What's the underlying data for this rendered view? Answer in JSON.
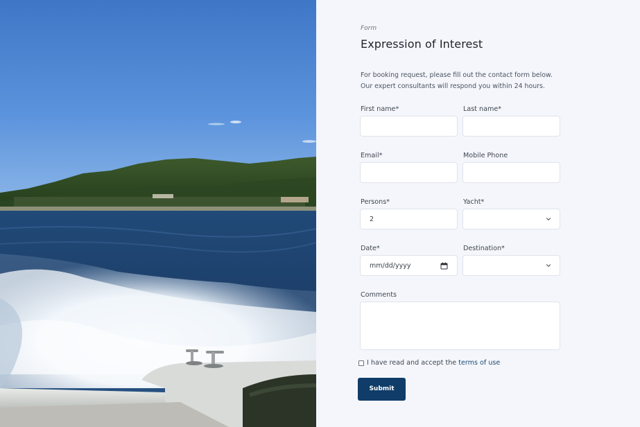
{
  "form": {
    "eyebrow": "Form",
    "title": "Expression of Interest",
    "intro": "For booking request, please fill out the contact form below. Our expert consultants will respond you within 24 hours.",
    "first_name_label": "First name*",
    "last_name_label": "Last name*",
    "email_label": "Email*",
    "mobile_label": "Mobile Phone",
    "persons_label": "Persons*",
    "persons_value": "2",
    "yacht_label": "Yacht*",
    "date_label": "Date*",
    "date_placeholder": "mm/dd/yyyy",
    "destination_label": "Destination*",
    "comments_label": "Comments",
    "agree_text": "I have read and accept the",
    "terms_link": "terms of use",
    "submit_label": "Submit"
  },
  "colors": {
    "accent": "#0f3c68",
    "link": "#1c4a73",
    "panel_bg": "#f4f6fb",
    "field_border": "#dfe3ea"
  },
  "icons": {
    "select_chevron": "chevron-down-icon",
    "calendar": "calendar-icon"
  }
}
